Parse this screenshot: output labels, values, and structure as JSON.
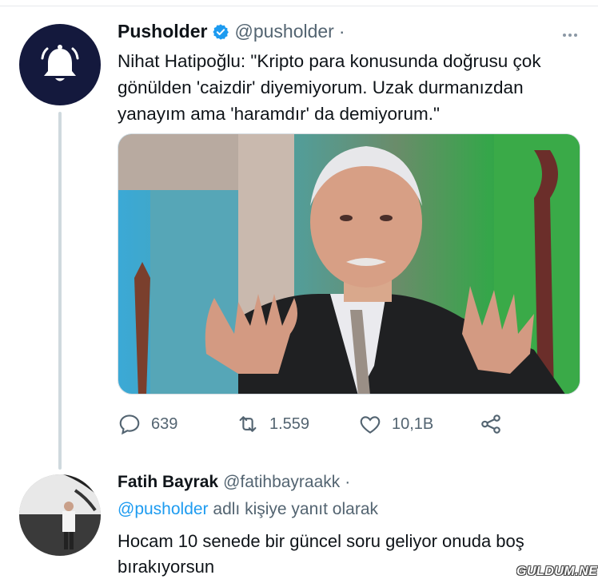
{
  "tweet": {
    "author_name": "Pusholder",
    "author_handle": "@pusholder",
    "separator": "·",
    "text": "Nihat Hatipoğlu: \"Kripto para konusunda doğrusu çok gönülden 'caizdir' diyemiyorum. Uzak durmanızdan yanayım ama 'haramdır' da demiyorum.\"",
    "avatar_icon": "bell-icon",
    "verified_icon": "verified-badge-icon",
    "actions": {
      "replies": "639",
      "retweets": "1.559",
      "likes": "10,1B"
    }
  },
  "reply": {
    "author_name": "Fatih Bayrak",
    "author_handle": "@fatihbayraakk",
    "separator": "·",
    "reply_to_mention": "@pusholder",
    "reply_to_suffix": " adlı kişiye yanıt olarak",
    "text": "Hocam 10 senede bir güncel soru geliyor onuda boş bırakıyorsun"
  },
  "watermark": "GULDUM.NET",
  "colors": {
    "avatar_bg": "#14193d",
    "verified": "#1d9bf0",
    "mention": "#1d9bf0",
    "muted_text": "#536471",
    "thread_line": "#cfd9de"
  }
}
